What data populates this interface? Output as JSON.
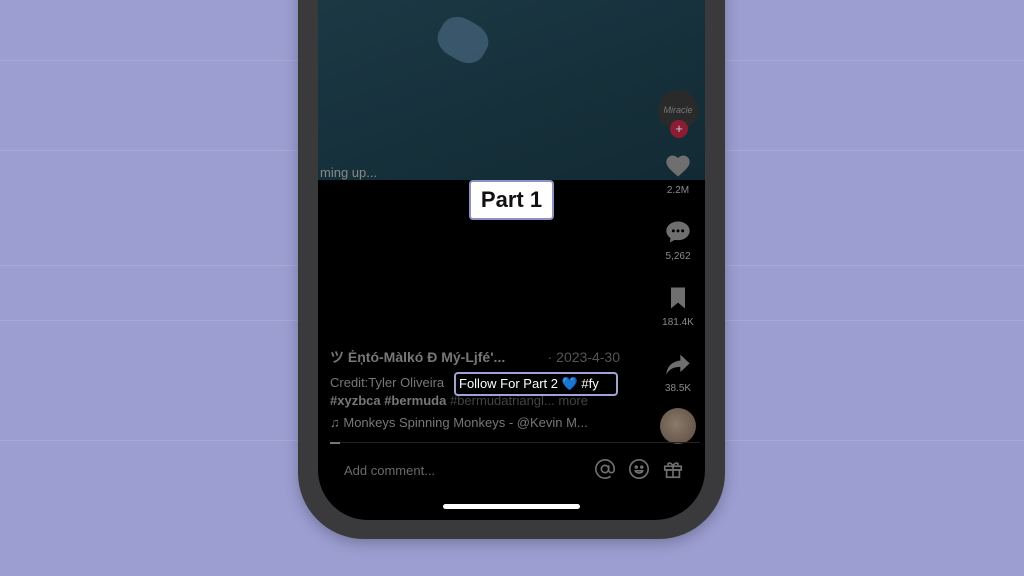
{
  "video": {
    "caption_fragment": "ming up..."
  },
  "rail": {
    "avatar_text": "Miracle",
    "likes": "2.2M",
    "comments": "5,262",
    "saves": "181.4K",
    "shares": "38.5K"
  },
  "post": {
    "author": "ツ Ėņtó-Màlkó Ð Mý-Ljfé'...",
    "date": "· 2023-4-30",
    "credit": "Credit:Tyler Oliveira",
    "tags_bright": "#xyzbca #bermuda",
    "tags_dim": "#bermudatriangl... more",
    "music": "♫ Monkeys Spinning Monkeys - @Kevin M..."
  },
  "comment_bar": {
    "placeholder": "Add comment..."
  },
  "overlays": {
    "part1": "Part 1",
    "follow": "Follow For Part 2 💙 #fy"
  },
  "colors": {
    "background": "#9c9ed2",
    "heart": "#1e90ff"
  }
}
